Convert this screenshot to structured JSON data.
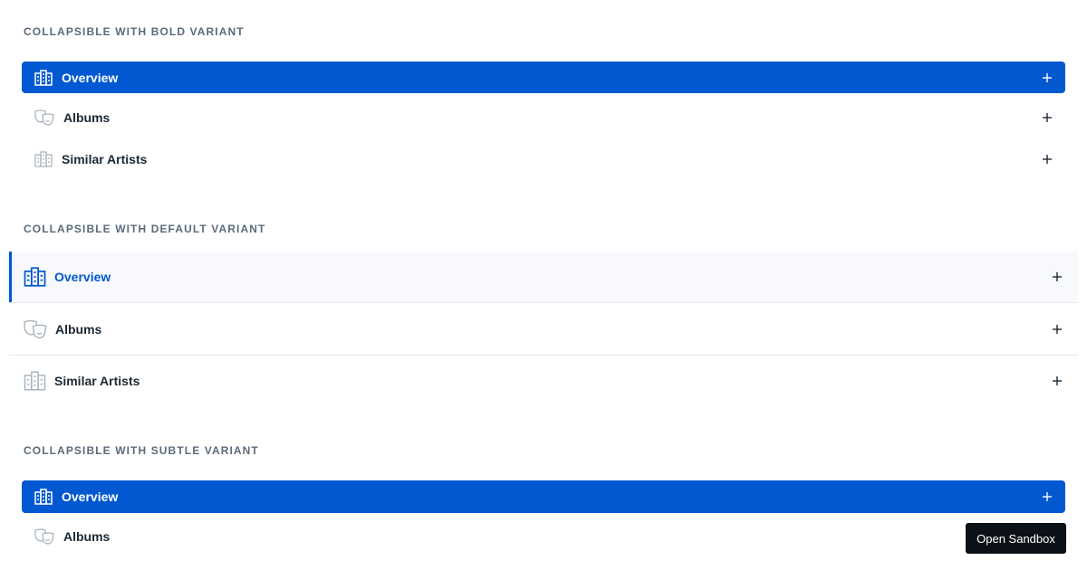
{
  "sections": [
    {
      "title": "COLLAPSIBLE WITH BOLD VARIANT",
      "items": [
        {
          "label": "Overview",
          "icon": "building-icon",
          "active": true
        },
        {
          "label": "Albums",
          "icon": "theater-masks-icon",
          "active": false
        },
        {
          "label": "Similar Artists",
          "icon": "building-icon",
          "active": false
        }
      ]
    },
    {
      "title": "COLLAPSIBLE WITH DEFAULT VARIANT",
      "items": [
        {
          "label": "Overview",
          "icon": "building-icon",
          "active": true
        },
        {
          "label": "Albums",
          "icon": "theater-masks-icon",
          "active": false
        },
        {
          "label": "Similar Artists",
          "icon": "building-icon",
          "active": false
        }
      ]
    },
    {
      "title": "COLLAPSIBLE WITH SUBTLE VARIANT",
      "items": [
        {
          "label": "Overview",
          "icon": "building-icon",
          "active": true
        },
        {
          "label": "Albums",
          "icon": "theater-masks-icon",
          "active": false
        }
      ]
    }
  ],
  "sandbox_button": "Open Sandbox",
  "colors": {
    "accent": "#0158d1",
    "muted_icon": "#aab4be",
    "section_title": "#5b6b7b"
  }
}
